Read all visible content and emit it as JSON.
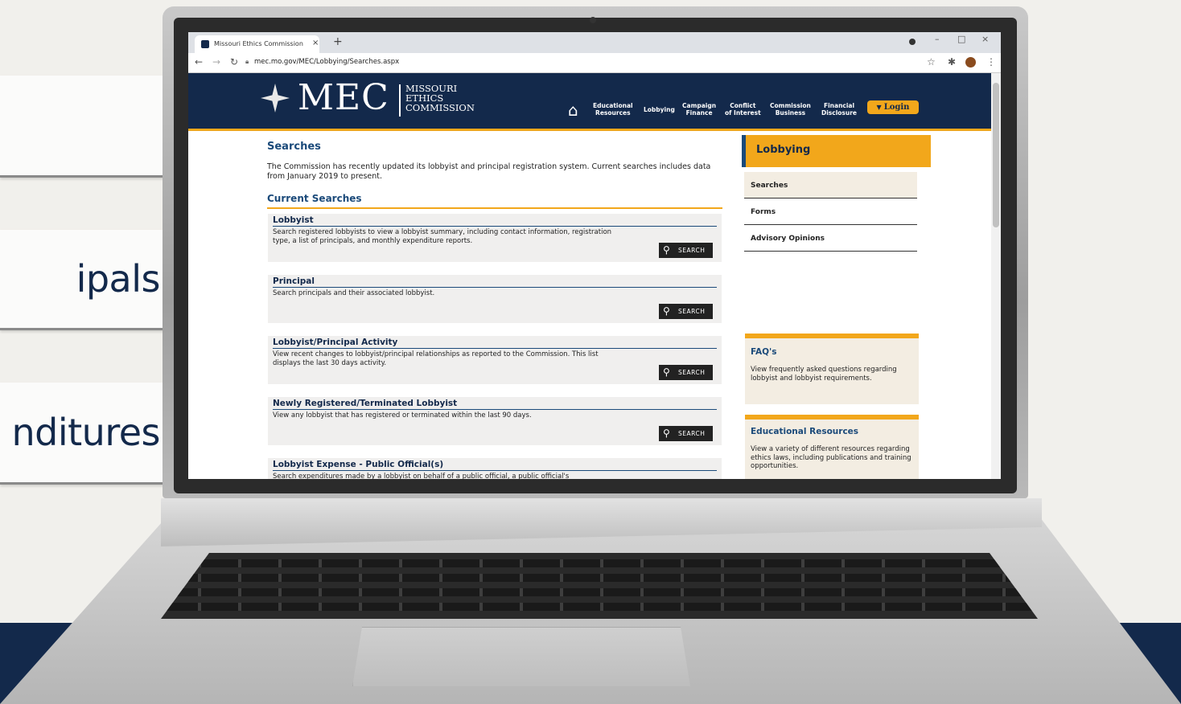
{
  "slide": {
    "panels": [
      "",
      "ipals",
      "nditures"
    ]
  },
  "browser": {
    "tab_title": "Missouri Ethics Commission",
    "tab_close": "×",
    "new_tab": "+",
    "url": "mec.mo.gov/MEC/Lobbying/Searches.aspx",
    "win_min": "–",
    "win_max": "□",
    "win_close": "×"
  },
  "header": {
    "logo_mec": "MEC",
    "logo_line1": "MISSOURI",
    "logo_line2": "ETHICS",
    "logo_line3": "COMMISSION",
    "nav": [
      "Educational\nResources",
      "Lobbying",
      "Campaign\nFinance",
      "Conflict\nof Interest",
      "Commission\nBusiness",
      "Financial\nDisclosure"
    ],
    "login": "Login"
  },
  "main": {
    "title": "Searches",
    "intro": "The Commission has recently updated its lobbyist and principal registration system. Current searches includes data from January 2019 to present.",
    "current_heading": "Current Searches",
    "search_label": "SEARCH",
    "cards": [
      {
        "title": "Lobbyist",
        "desc": "Search registered lobbyists to view a lobbyist summary, including contact information, registration type, a list of principals, and monthly expenditure reports."
      },
      {
        "title": "Principal",
        "desc": "Search principals and their associated lobbyist."
      },
      {
        "title": "Lobbyist/Principal Activity",
        "desc": "View recent changes to lobbyist/principal relationships as reported to the Commission. This list displays the last 30 days activity."
      },
      {
        "title": "Newly Registered/Terminated Lobbyist",
        "desc": "View any lobbyist that has registered or terminated within the last 90 days."
      },
      {
        "title": "Lobbyist Expense - Public Official(s)",
        "desc": "Search expenditures made by a lobbyist on behalf of a public official, a public official's"
      }
    ]
  },
  "sidebar": {
    "heading": "Lobbying",
    "items": [
      "Searches",
      "Forms",
      "Advisory Opinions"
    ],
    "faq_title": "FAQ's",
    "faq_desc": "View frequently asked questions regarding lobbyist and lobbyist requirements.",
    "edu_title": "Educational Resources",
    "edu_desc": "View a variety of different resources regarding ethics laws, including publications and training opportunities."
  },
  "colors": {
    "navy": "#13294b",
    "gold": "#f2a71b",
    "link_blue": "#1b4a7a"
  }
}
